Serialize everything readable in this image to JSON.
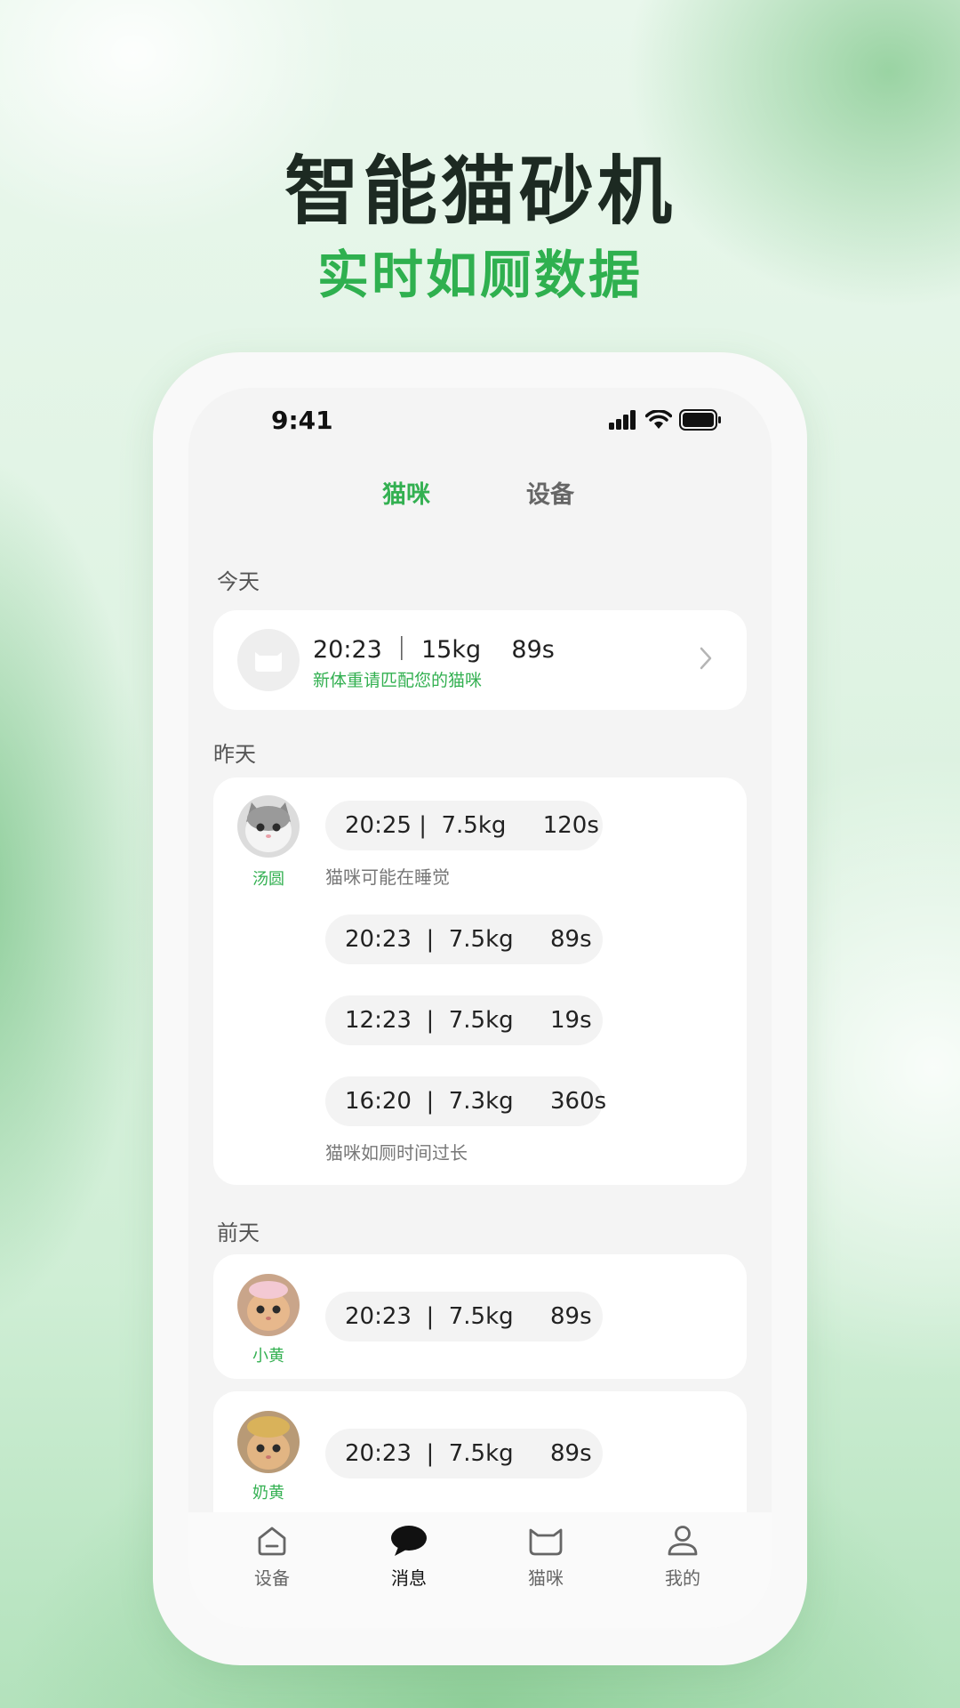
{
  "promo": {
    "title": "智能猫砂机",
    "subtitle": "实时如厕数据"
  },
  "status_bar": {
    "time": "9:41"
  },
  "top_tabs": [
    {
      "label": "猫咪",
      "active": true
    },
    {
      "label": "设备",
      "active": false
    }
  ],
  "sections": {
    "today": "今天",
    "yesterday": "昨天",
    "day_before": "前天"
  },
  "today_record": {
    "record": "20:23 ｜ 15kg    89s",
    "hint": "新体重请匹配您的猫咪"
  },
  "yesterday_group": {
    "cat_name": "汤圆",
    "records": [
      "20:25 |  7.5kg     120s",
      "20:23  |  7.5kg     89s",
      "12:23  |  7.5kg     19s",
      "16:20  |  7.3kg     360s"
    ],
    "note_first": "猫咪可能在睡觉",
    "note_last": "猫咪如厕时间过长"
  },
  "day_before_groups": [
    {
      "cat_name": "小黄",
      "record": "20:23  |  7.5kg     89s"
    },
    {
      "cat_name": "奶黄",
      "record": "20:23  |  7.5kg     89s"
    }
  ],
  "bottom_nav": [
    {
      "label": "设备",
      "icon": "home-icon",
      "active": false
    },
    {
      "label": "消息",
      "icon": "chat-bubble-icon",
      "active": true
    },
    {
      "label": "猫咪",
      "icon": "cat-icon",
      "active": false
    },
    {
      "label": "我的",
      "icon": "user-icon",
      "active": false
    }
  ],
  "colors": {
    "accent": "#33b051",
    "title": "#1d2a22",
    "subtitle": "#2fb04f"
  }
}
